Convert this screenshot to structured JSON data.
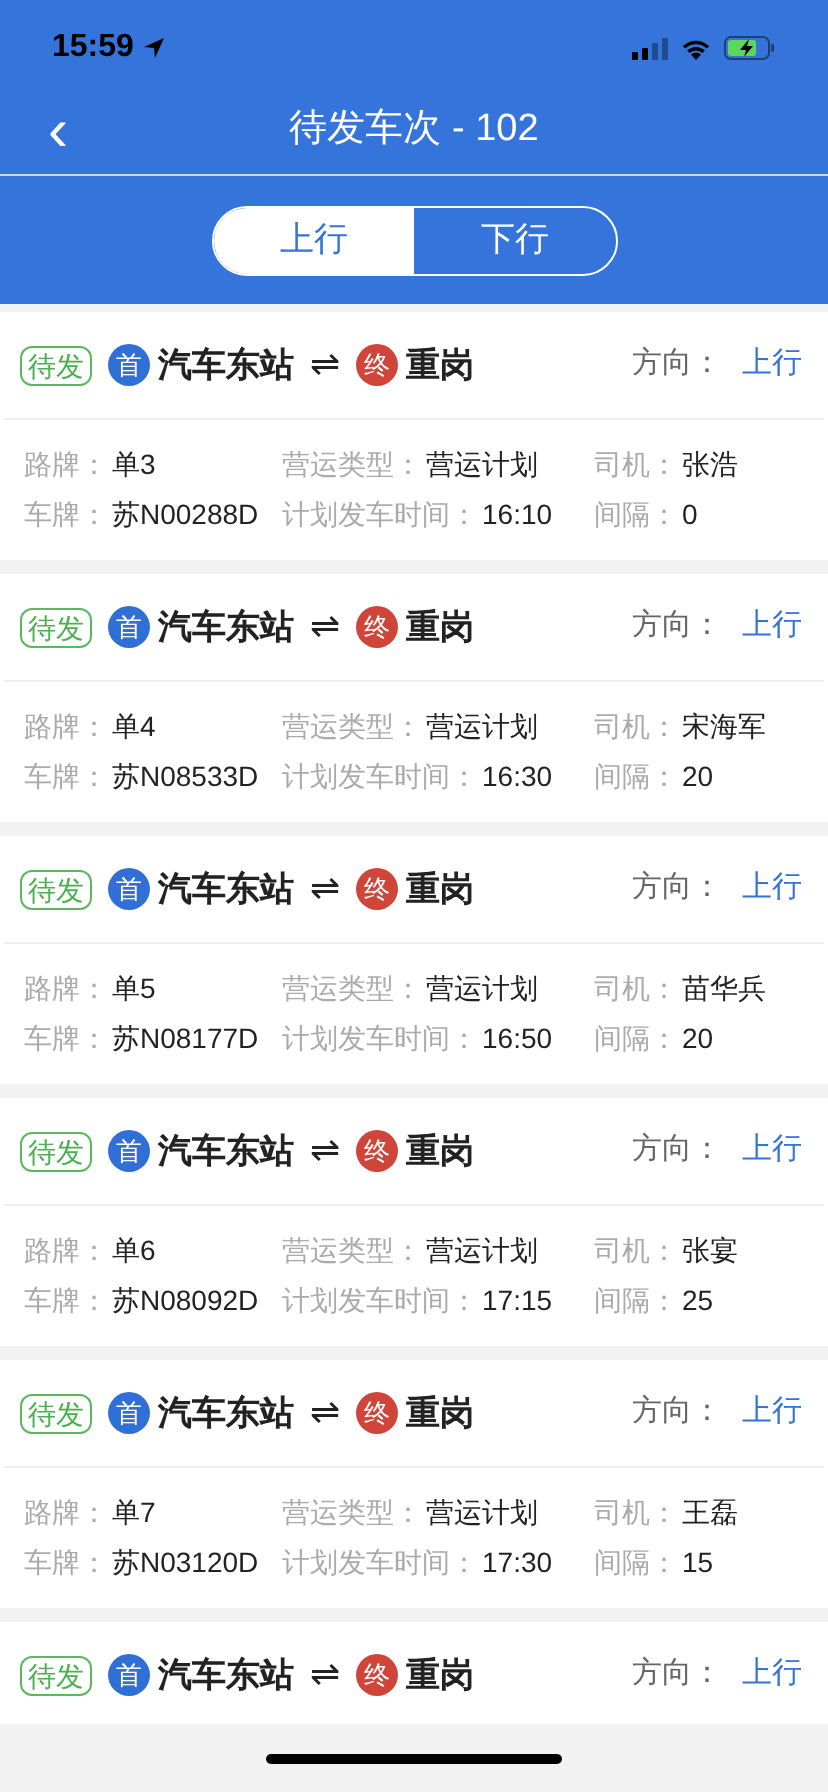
{
  "status_bar": {
    "time": "15:59"
  },
  "nav": {
    "back": "‹",
    "title": "待发车次 - 102"
  },
  "tabs": [
    {
      "label": "上行",
      "selected": true
    },
    {
      "label": "下行",
      "selected": false
    }
  ],
  "trips": [
    {
      "status": "待发",
      "start_badge": "首",
      "start": "汽车东站",
      "arrow": "⇌",
      "end_badge": "终",
      "end": "重岗",
      "direction_label": "方向：",
      "direction": "上行",
      "fields": [
        {
          "label": "路牌：",
          "value": "单3"
        },
        {
          "label": "营运类型：",
          "value": "营运计划"
        },
        {
          "label": "司机：",
          "value": "张浩"
        },
        {
          "label": "车牌：",
          "value": "苏N00288D"
        },
        {
          "label": "计划发车时间：",
          "value": "16:10"
        },
        {
          "label": "间隔：",
          "value": "0"
        }
      ]
    },
    {
      "status": "待发",
      "start_badge": "首",
      "start": "汽车东站",
      "arrow": "⇌",
      "end_badge": "终",
      "end": "重岗",
      "direction_label": "方向：",
      "direction": "上行",
      "fields": [
        {
          "label": "路牌：",
          "value": "单4"
        },
        {
          "label": "营运类型：",
          "value": "营运计划"
        },
        {
          "label": "司机：",
          "value": "宋海军"
        },
        {
          "label": "车牌：",
          "value": "苏N08533D"
        },
        {
          "label": "计划发车时间：",
          "value": "16:30"
        },
        {
          "label": "间隔：",
          "value": "20"
        }
      ]
    },
    {
      "status": "待发",
      "start_badge": "首",
      "start": "汽车东站",
      "arrow": "⇌",
      "end_badge": "终",
      "end": "重岗",
      "direction_label": "方向：",
      "direction": "上行",
      "fields": [
        {
          "label": "路牌：",
          "value": "单5"
        },
        {
          "label": "营运类型：",
          "value": "营运计划"
        },
        {
          "label": "司机：",
          "value": "苗华兵"
        },
        {
          "label": "车牌：",
          "value": "苏N08177D"
        },
        {
          "label": "计划发车时间：",
          "value": "16:50"
        },
        {
          "label": "间隔：",
          "value": "20"
        }
      ]
    },
    {
      "status": "待发",
      "start_badge": "首",
      "start": "汽车东站",
      "arrow": "⇌",
      "end_badge": "终",
      "end": "重岗",
      "direction_label": "方向：",
      "direction": "上行",
      "fields": [
        {
          "label": "路牌：",
          "value": "单6"
        },
        {
          "label": "营运类型：",
          "value": "营运计划"
        },
        {
          "label": "司机：",
          "value": "张宴"
        },
        {
          "label": "车牌：",
          "value": "苏N08092D"
        },
        {
          "label": "计划发车时间：",
          "value": "17:15"
        },
        {
          "label": "间隔：",
          "value": "25"
        }
      ]
    },
    {
      "status": "待发",
      "start_badge": "首",
      "start": "汽车东站",
      "arrow": "⇌",
      "end_badge": "终",
      "end": "重岗",
      "direction_label": "方向：",
      "direction": "上行",
      "fields": [
        {
          "label": "路牌：",
          "value": "单7"
        },
        {
          "label": "营运类型：",
          "value": "营运计划"
        },
        {
          "label": "司机：",
          "value": "王磊"
        },
        {
          "label": "车牌：",
          "value": "苏N03120D"
        },
        {
          "label": "计划发车时间：",
          "value": "17:30"
        },
        {
          "label": "间隔：",
          "value": "15"
        }
      ]
    },
    {
      "status": "待发",
      "start_badge": "首",
      "start": "汽车东站",
      "arrow": "⇌",
      "end_badge": "终",
      "end": "重岗",
      "direction_label": "方向：",
      "direction": "上行"
    }
  ]
}
